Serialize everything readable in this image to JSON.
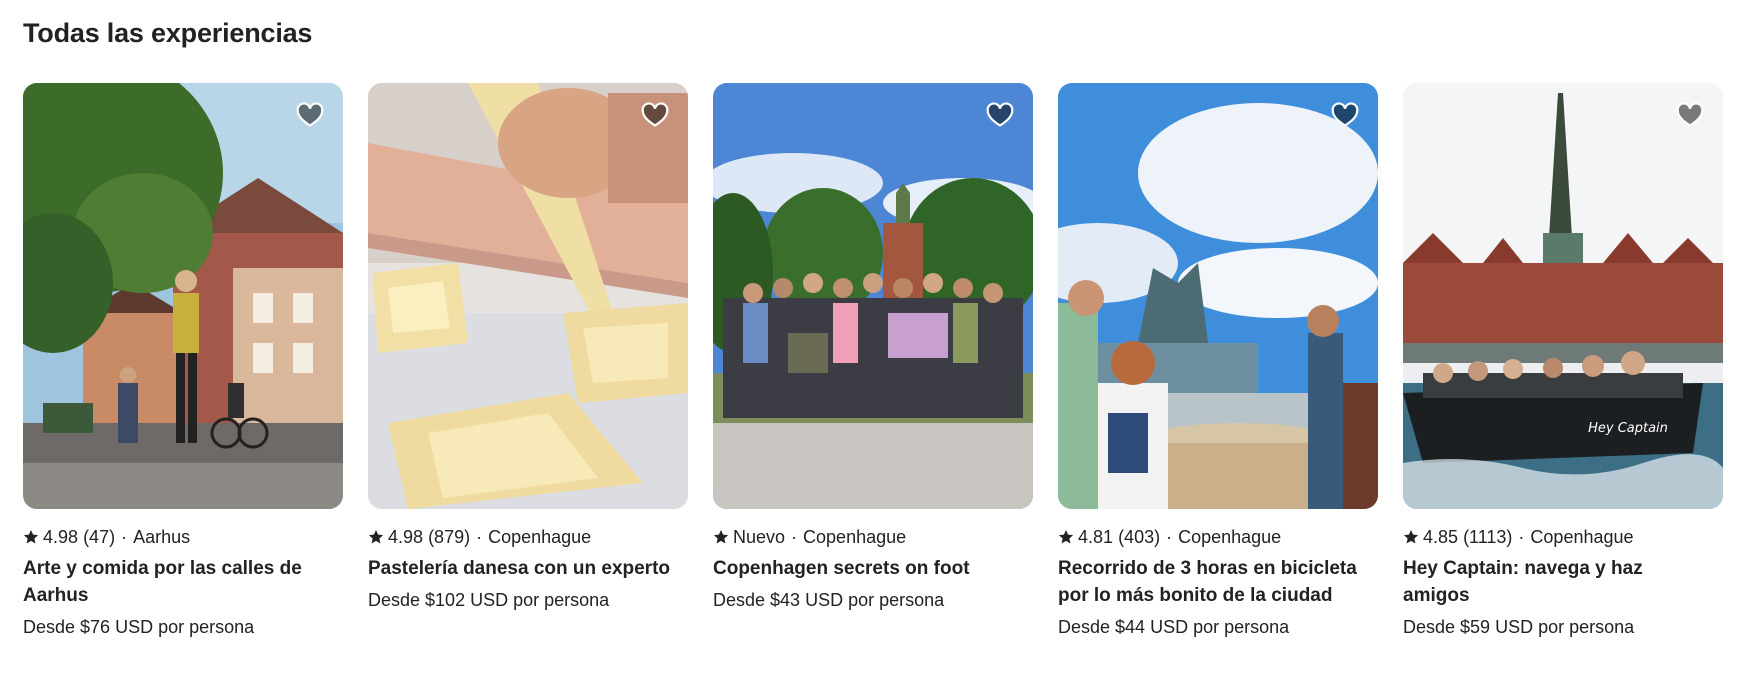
{
  "section": {
    "title": "Todas las experiencias"
  },
  "cards": [
    {
      "rating": "4.98",
      "reviews": "(47)",
      "location": "Aarhus",
      "title": "Arte y comida por las calles de Aarhus",
      "price": "Desde $76 USD por persona"
    },
    {
      "rating": "4.98",
      "reviews": "(879)",
      "location": "Copenhague",
      "title": "Pastelería danesa con un experto",
      "price": "Desde $102 USD por persona"
    },
    {
      "rating": "Nuevo",
      "reviews": "",
      "location": "Copenhague",
      "title": "Copenhagen secrets on foot",
      "price": "Desde $43 USD por persona"
    },
    {
      "rating": "4.81",
      "reviews": "(403)",
      "location": "Copenhague",
      "title": "Recorrido de 3 horas en bicicleta por lo más bonito de la ciudad",
      "price": "Desde $44 USD por persona"
    },
    {
      "rating": "4.85",
      "reviews": "(1113)",
      "location": "Copenhague",
      "title": "Hey Captain: navega y haz amigos",
      "price": "Desde $59 USD por persona"
    }
  ],
  "separator": "·",
  "boat_sign": "Hey Captain",
  "icons": {
    "favorite": "heart-icon",
    "rating": "star-icon"
  },
  "colors": {
    "text": "#222222",
    "heart_fill": "rgba(0,0,0,0.5)",
    "heart_stroke": "#ffffff"
  }
}
